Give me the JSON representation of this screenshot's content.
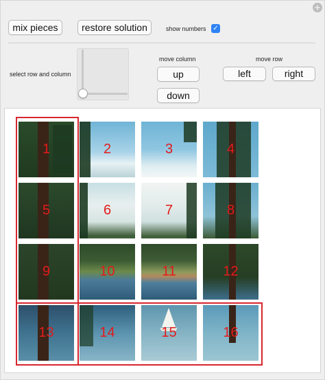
{
  "controls": {
    "mix_label": "mix pieces",
    "restore_label": "restore solution",
    "show_numbers_label": "show numbers",
    "show_numbers_checked": true,
    "select_label": "select row and column",
    "move_column_label": "move column",
    "up_label": "up",
    "down_label": "down",
    "move_row_label": "move row",
    "left_label": "left",
    "right_label": "right"
  },
  "puzzle": {
    "tiles": [
      "1",
      "2",
      "3",
      "4",
      "5",
      "6",
      "7",
      "8",
      "9",
      "10",
      "11",
      "12",
      "13",
      "14",
      "15",
      "16"
    ],
    "selected_column": 1,
    "selected_row": 4
  },
  "colors": {
    "highlight": "#d7262e",
    "number": "#e31b1b",
    "checkbox": "#2e83f4"
  }
}
